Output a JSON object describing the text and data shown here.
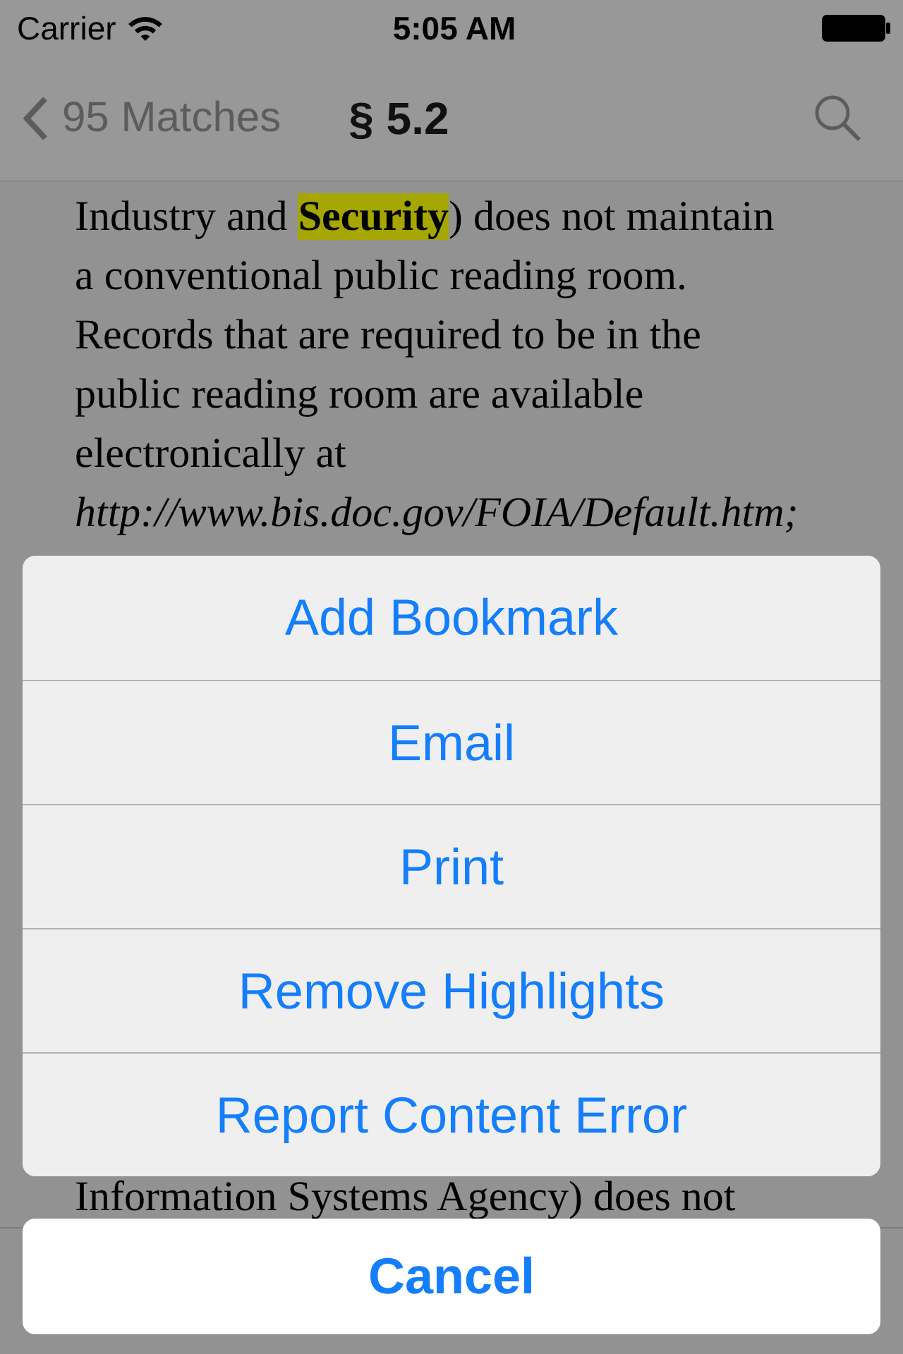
{
  "status_bar": {
    "carrier": "Carrier",
    "time": "5:05 AM"
  },
  "nav_bar": {
    "back": "95 Matches",
    "title": "§ 5.2"
  },
  "document": {
    "lines": [
      {
        "segments": [
          {
            "text": "Industry and ",
            "highlighted": false
          },
          {
            "text": "**Security**",
            "highlighted": true
          },
          {
            "text": ") does not maintain",
            "highlighted": false
          }
        ]
      },
      {
        "segments": [
          {
            "text": "a conventional public reading room.",
            "highlighted": false
          }
        ]
      },
      {
        "segments": [
          {
            "text": "Records that are required to be in the",
            "highlighted": false
          }
        ]
      },
      {
        "segments": [
          {
            "text": "public reading room are available",
            "highlighted": false
          }
        ]
      },
      {
        "segments": [
          {
            "text": "electronically at",
            "highlighted": false
          }
        ]
      },
      {
        "segments": [
          {
            "text": "*http://www.bis.doc.gov/FOIA/Default.htm;*",
            "highlighted": false
          }
        ]
      }
    ],
    "trailing_line": "Information Systems Agency) does not"
  },
  "action_sheet": {
    "actions": [
      "Add Bookmark",
      "Email",
      "Print",
      "Remove Highlights",
      "Report Content Error"
    ],
    "cancel": "Cancel"
  }
}
